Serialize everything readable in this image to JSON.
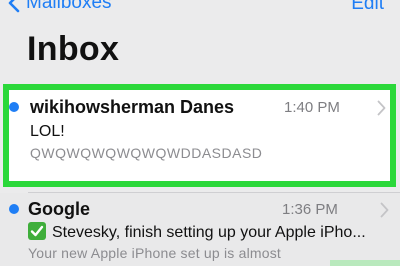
{
  "nav": {
    "back_label": "Mailboxes",
    "edit_label": "Edit"
  },
  "title": "Inbox",
  "messages": [
    {
      "sender": "wikihowsherman Danes",
      "time": "1:40 PM",
      "subject": "LOL!",
      "preview": "QWQWQWQWQWQWDDASDASD",
      "unread": true,
      "highlighted": true
    },
    {
      "sender": "Google",
      "time": "1:36 PM",
      "subject": "Stevesky, finish setting up your Apple iPho...",
      "preview": "Your new Apple iPhone set up is almost",
      "unread": true,
      "subject_icon": "green-checkmark-icon",
      "highlighted": false
    }
  ],
  "colors": {
    "accent": "#1f7ef5",
    "highlight": "#2bd83a",
    "check": "#3fae3b"
  }
}
